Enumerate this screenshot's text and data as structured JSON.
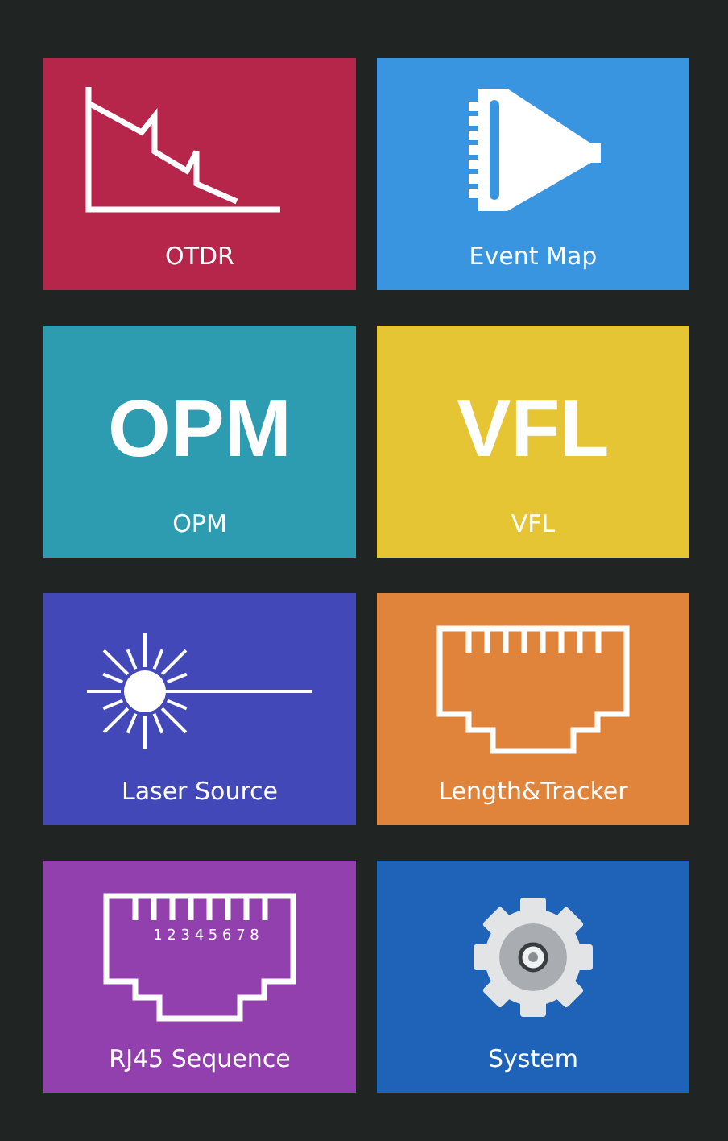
{
  "tiles": [
    {
      "label": "OTDR",
      "kind": "trace",
      "color": "#b5264a"
    },
    {
      "label": "Event Map",
      "kind": "connector",
      "color": "#3a95e0"
    },
    {
      "label": "OPM",
      "kind": "glyph",
      "glyph": "OPM",
      "color": "#2e9cb0"
    },
    {
      "label": "VFL",
      "kind": "glyph",
      "glyph": "VFL",
      "color": "#e6c534"
    },
    {
      "label": "Laser Source",
      "kind": "laser",
      "color": "#4248b8"
    },
    {
      "label": "Length&Tracker",
      "kind": "port",
      "color": "#df843a"
    },
    {
      "label": "RJ45 Sequence",
      "kind": "port",
      "pins": "1 2 3 4 5 6 7 8",
      "color": "#9140ad"
    },
    {
      "label": "System",
      "kind": "gear",
      "color": "#1e63b8"
    }
  ]
}
